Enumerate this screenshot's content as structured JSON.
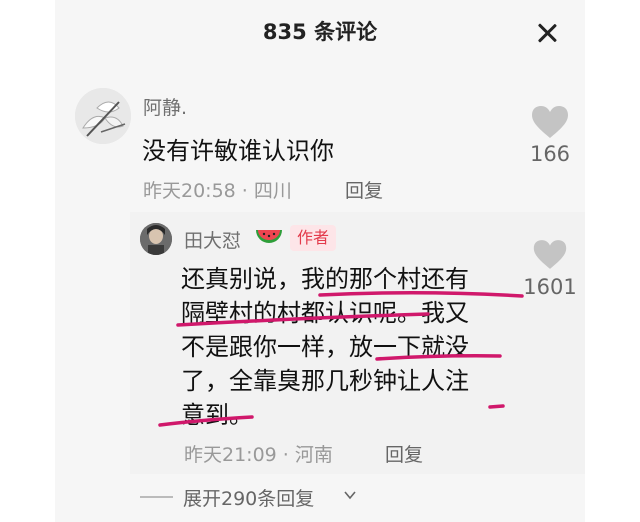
{
  "header": {
    "title": "835 条评论"
  },
  "comment": {
    "user": "阿静.",
    "text": "没有许敏谁认识你",
    "time_location": "昨天20:58 · 四川",
    "reply_label": "回复",
    "likes": "166"
  },
  "reply": {
    "user": "田大怼",
    "badge": "作者",
    "lines": [
      "还真别说，我的那个村还有",
      "隔壁村的村都认识呢。我又",
      "不是跟你一样，放一下就没",
      "了，全靠臭那几秒钟让人注",
      "意到。"
    ],
    "time_location": "昨天21:09 · 河南",
    "reply_label": "回复",
    "likes": "1601"
  },
  "expand": {
    "label": "展开290条回复"
  },
  "colors": {
    "underline": "#d0186b",
    "badge_text": "#e33b4c",
    "badge_bg": "#fde5e8"
  }
}
